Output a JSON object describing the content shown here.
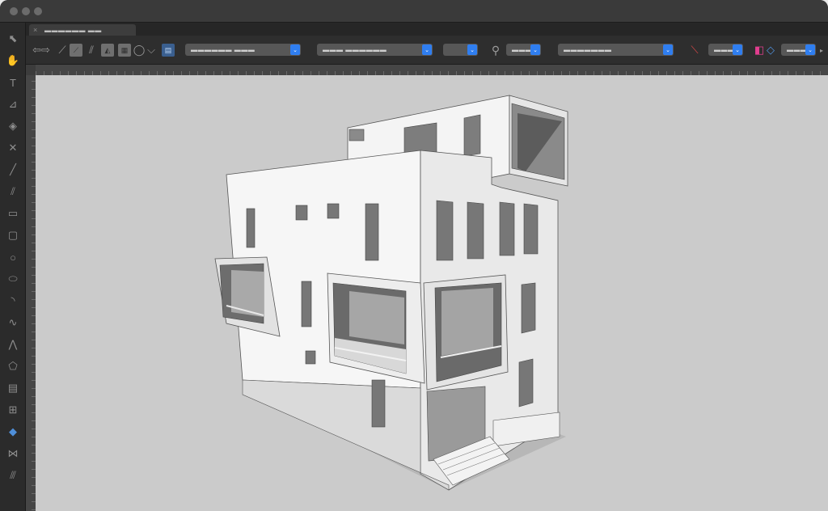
{
  "window": {
    "document_tab": {
      "label": "▬▬▬▬▬▬ ▬▬",
      "close_glyph": "×"
    }
  },
  "toolbar": {
    "icons": [
      "nav-arrows-icon",
      "pencil-icon",
      "line-tool-icon",
      "double-line-icon",
      "render-mode-icon",
      "rectangle-mode-icon",
      "lasso-icon",
      "layout-icon",
      "zoom-icon",
      "snap-icon",
      "layer-icon"
    ],
    "selects": [
      {
        "name": "class-select",
        "value": "▬▬▬▬▬▬ ▬▬▬"
      },
      {
        "name": "layer-select",
        "value": "▬▬▬ ▬▬▬▬▬▬"
      },
      {
        "name": "scale-select",
        "value": ""
      },
      {
        "name": "zoom-select",
        "value": "▬▬▬"
      },
      {
        "name": "view-select",
        "value": "▬▬▬▬▬▬▬"
      },
      {
        "name": "render-select",
        "value": "▬▬▬"
      },
      {
        "name": "projection-select",
        "value": "▬▬▬"
      }
    ],
    "overflow_glyph": "▸"
  },
  "tools": [
    {
      "name": "selection-tool-icon",
      "glyph": "⬉"
    },
    {
      "name": "pan-tool-icon",
      "glyph": "✋"
    },
    {
      "name": "text-tool-icon",
      "glyph": "T"
    },
    {
      "name": "callout-tool-icon",
      "glyph": "⊿"
    },
    {
      "name": "attribute-tool-icon",
      "glyph": "◈"
    },
    {
      "name": "locus-tool-icon",
      "glyph": "✕"
    },
    {
      "name": "line-tool-icon",
      "glyph": "╱"
    },
    {
      "name": "double-line-tool-icon",
      "glyph": "⫽"
    },
    {
      "name": "rectangle-tool-icon",
      "glyph": "▭"
    },
    {
      "name": "rounded-rectangle-tool-icon",
      "glyph": "▢"
    },
    {
      "name": "circle-tool-icon",
      "glyph": "○"
    },
    {
      "name": "oval-tool-icon",
      "glyph": "⬭"
    },
    {
      "name": "arc-tool-icon",
      "glyph": "◝"
    },
    {
      "name": "freehand-tool-icon",
      "glyph": "∿"
    },
    {
      "name": "polyline-tool-icon",
      "glyph": "⋀"
    },
    {
      "name": "polygon-tool-icon",
      "glyph": "⬠"
    },
    {
      "name": "wall-tool-icon",
      "glyph": "▤"
    },
    {
      "name": "window-tool-icon",
      "glyph": "⊞"
    },
    {
      "name": "3d-tool-icon",
      "glyph": "◆",
      "active": true
    },
    {
      "name": "mirror-tool-icon",
      "glyph": "⋈"
    },
    {
      "name": "dimension-tool-icon",
      "glyph": "⫻"
    }
  ],
  "colors": {
    "accent": "#2f7ef0",
    "active_tool": "#4f8fd9",
    "canvas": "#cbcbcb"
  }
}
